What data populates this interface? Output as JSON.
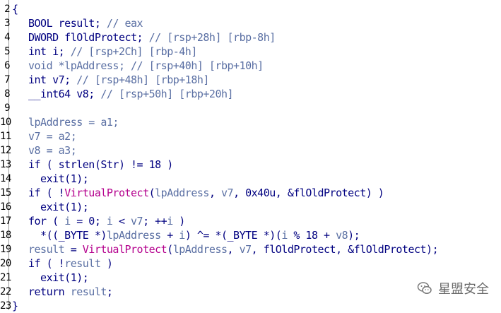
{
  "lines": [
    {
      "n": "2",
      "segs": [
        {
          "t": "{",
          "c": "k"
        }
      ]
    },
    {
      "n": "3",
      "segs": [
        {
          "t": "BOOL result; ",
          "c": "k"
        },
        {
          "t": "// eax",
          "c": "c"
        }
      ]
    },
    {
      "n": "4",
      "segs": [
        {
          "t": "DWORD flOldProtect; ",
          "c": "k"
        },
        {
          "t": "// [rsp+28h] [rbp-8h]",
          "c": "c"
        }
      ]
    },
    {
      "n": "5",
      "segs": [
        {
          "t": "int i; ",
          "c": "k"
        },
        {
          "t": "// [rsp+2Ch] [rbp-4h]",
          "c": "c"
        }
      ]
    },
    {
      "n": "6",
      "segs": [
        {
          "t": "void *lpAddress; ",
          "c": "v"
        },
        {
          "t": "// [rsp+40h] [rbp+10h]",
          "c": "c"
        }
      ]
    },
    {
      "n": "7",
      "segs": [
        {
          "t": "int v7; ",
          "c": "k"
        },
        {
          "t": "// [rsp+48h] [rbp+18h]",
          "c": "c"
        }
      ]
    },
    {
      "n": "8",
      "segs": [
        {
          "t": "__int64 v8; ",
          "c": "k"
        },
        {
          "t": "// [rsp+50h] [rbp+20h]",
          "c": "c"
        }
      ]
    },
    {
      "n": "9",
      "segs": []
    },
    {
      "n": "10",
      "segs": [
        {
          "t": "lpAddress = a1;",
          "c": "v"
        }
      ]
    },
    {
      "n": "11",
      "segs": [
        {
          "t": "v7 = a2;",
          "c": "v"
        }
      ]
    },
    {
      "n": "12",
      "segs": [
        {
          "t": "v8 = a3;",
          "c": "v"
        }
      ]
    },
    {
      "n": "13",
      "segs": [
        {
          "t": "if ( strlen(Str) != 18 )",
          "c": "k"
        }
      ]
    },
    {
      "n": "14",
      "segs": [
        {
          "t": "  exit(1);",
          "c": "k"
        }
      ]
    },
    {
      "n": "15",
      "segs": [
        {
          "t": "if ( !",
          "c": "k"
        },
        {
          "t": "VirtualProtect",
          "c": "fn"
        },
        {
          "t": "(",
          "c": "k"
        },
        {
          "t": "lpAddress",
          "c": "v"
        },
        {
          "t": ", ",
          "c": "k"
        },
        {
          "t": "v7",
          "c": "v"
        },
        {
          "t": ", 0x40u, &flOldProtect) )",
          "c": "k"
        }
      ]
    },
    {
      "n": "16",
      "segs": [
        {
          "t": "  exit(1);",
          "c": "k"
        }
      ]
    },
    {
      "n": "17",
      "segs": [
        {
          "t": "for ( ",
          "c": "k"
        },
        {
          "t": "i",
          "c": "v"
        },
        {
          "t": " = 0; ",
          "c": "k"
        },
        {
          "t": "i",
          "c": "v"
        },
        {
          "t": " < ",
          "c": "k"
        },
        {
          "t": "v7",
          "c": "v"
        },
        {
          "t": "; ++",
          "c": "k"
        },
        {
          "t": "i",
          "c": "v"
        },
        {
          "t": " )",
          "c": "k"
        }
      ]
    },
    {
      "n": "18",
      "segs": [
        {
          "t": "  *((_BYTE *)",
          "c": "k"
        },
        {
          "t": "lpAddress",
          "c": "v"
        },
        {
          "t": " + ",
          "c": "k"
        },
        {
          "t": "i",
          "c": "v"
        },
        {
          "t": ") ^= *(_BYTE *)(",
          "c": "k"
        },
        {
          "t": "i",
          "c": "v"
        },
        {
          "t": " % 18 + ",
          "c": "k"
        },
        {
          "t": "v8",
          "c": "v"
        },
        {
          "t": ");",
          "c": "k"
        }
      ]
    },
    {
      "n": "19",
      "segs": [
        {
          "t": "result",
          "c": "v"
        },
        {
          "t": " = ",
          "c": "k"
        },
        {
          "t": "VirtualProtect",
          "c": "fn"
        },
        {
          "t": "(",
          "c": "k"
        },
        {
          "t": "lpAddress",
          "c": "v"
        },
        {
          "t": ", ",
          "c": "k"
        },
        {
          "t": "v7",
          "c": "v"
        },
        {
          "t": ", flOldProtect, &flOldProtect);",
          "c": "k"
        }
      ]
    },
    {
      "n": "20",
      "segs": [
        {
          "t": "if ( !",
          "c": "k"
        },
        {
          "t": "result",
          "c": "v"
        },
        {
          "t": " )",
          "c": "k"
        }
      ]
    },
    {
      "n": "21",
      "segs": [
        {
          "t": "  exit(1);",
          "c": "k"
        }
      ]
    },
    {
      "n": "22",
      "segs": [
        {
          "t": "return ",
          "c": "k"
        },
        {
          "t": "result",
          "c": "v"
        },
        {
          "t": ";",
          "c": "k"
        }
      ]
    },
    {
      "n": "23",
      "segs": [
        {
          "t": "}",
          "c": "k"
        }
      ]
    }
  ],
  "watermark": {
    "text": "星盟安全",
    "icon": "wechat-icon"
  },
  "colors": {
    "keyword": "#000080",
    "variable": "#5a6fa3",
    "comment": "#5a6fa3",
    "function": "#b4008d"
  }
}
